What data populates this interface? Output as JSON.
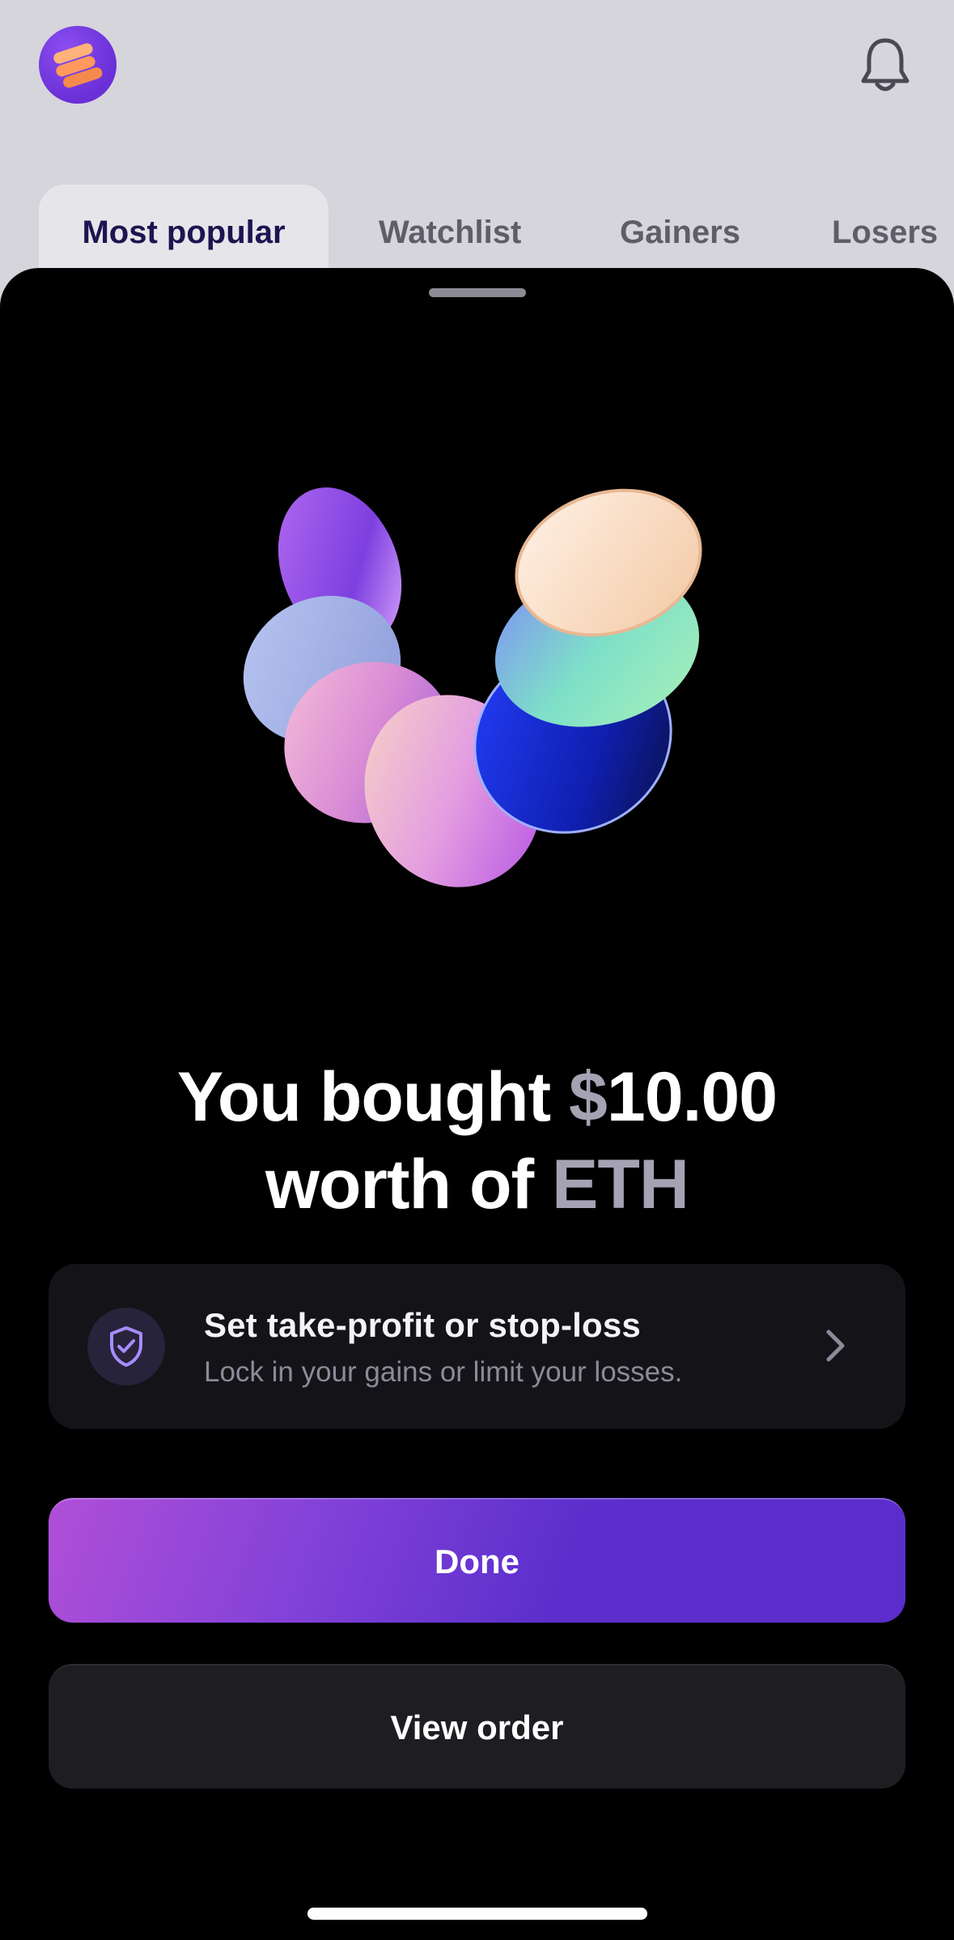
{
  "header": {
    "logo_icon": "stacked-coins-logo-icon",
    "bell_icon": "bell-icon"
  },
  "tabs": [
    {
      "label": "Most popular",
      "active": true
    },
    {
      "label": "Watchlist",
      "active": false
    },
    {
      "label": "Gainers",
      "active": false
    },
    {
      "label": "Losers",
      "active": false
    }
  ],
  "sheet": {
    "illustration": "floating-coins-illustration",
    "headline": {
      "line1_prefix": "You bought ",
      "currency_symbol": "$",
      "amount": "10.00",
      "line2_prefix": "worth of ",
      "asset": "ETH"
    },
    "card": {
      "icon": "shield-check-icon",
      "title": "Set take-profit or stop-loss",
      "subtitle": "Lock in your gains or limit your losses.",
      "chevron": "chevron-right-icon"
    },
    "done_label": "Done",
    "view_order_label": "View order"
  },
  "colors": {
    "accent": "#5b2dcb",
    "accent_start": "#b04fd8",
    "sheet_bg": "#000000",
    "card_bg": "#141318"
  }
}
